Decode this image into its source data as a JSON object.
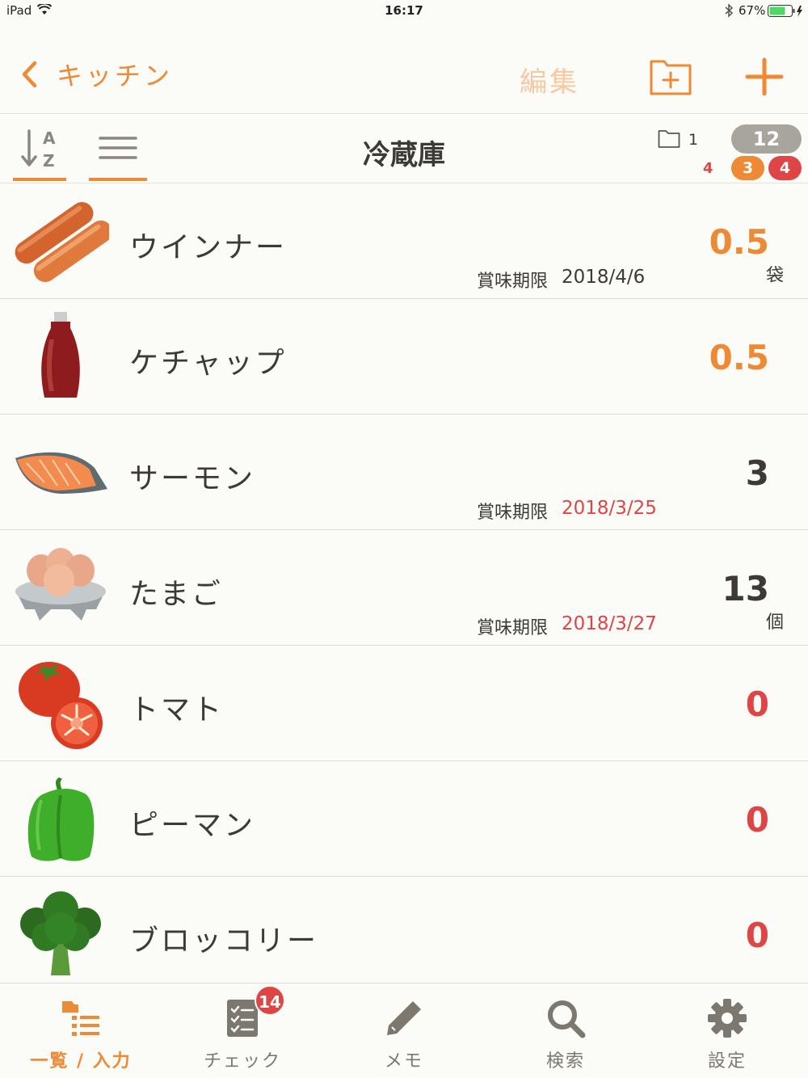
{
  "status_bar": {
    "device": "iPad",
    "time": "16:17",
    "battery": "67%"
  },
  "nav": {
    "back_label": "キッチン",
    "edit_label": "編集",
    "back_icon": "chevron-left-icon",
    "add_folder_icon": "folder-plus-icon",
    "add_icon": "plus-icon"
  },
  "toolbar": {
    "title": "冷蔵庫",
    "folder_count": "1",
    "warning_count": "4",
    "total_badge": "12",
    "orange_badge": "3",
    "red_badge": "4"
  },
  "items": [
    {
      "name": "ウインナー",
      "quantity": "0.5",
      "unit": "袋",
      "expiry_label": "賞味期限",
      "expiry_date": "2018/4/6",
      "icon": "sausage"
    },
    {
      "name": "ケチャップ",
      "quantity": "0.5",
      "unit": "",
      "expiry_label": "",
      "expiry_date": "",
      "icon": "ketchup"
    },
    {
      "name": "サーモン",
      "quantity": "3",
      "unit": "",
      "expiry_label": "賞味期限",
      "expiry_date": "2018/3/25",
      "icon": "salmon"
    },
    {
      "name": "たまご",
      "quantity": "13",
      "unit": "個",
      "expiry_label": "賞味期限",
      "expiry_date": "2018/3/27",
      "icon": "eggs"
    },
    {
      "name": "トマト",
      "quantity": "0",
      "unit": "",
      "expiry_label": "",
      "expiry_date": "",
      "icon": "tomato"
    },
    {
      "name": "ピーマン",
      "quantity": "0",
      "unit": "",
      "expiry_label": "",
      "expiry_date": "",
      "icon": "green-pepper"
    },
    {
      "name": "ブロッコリー",
      "quantity": "0",
      "unit": "",
      "expiry_label": "",
      "expiry_date": "",
      "icon": "broccoli"
    }
  ],
  "tabs": [
    {
      "label": "一覧 / 入力",
      "icon": "list-icon",
      "active": true
    },
    {
      "label": "チェック",
      "icon": "checklist-icon",
      "badge": "14"
    },
    {
      "label": "メモ",
      "icon": "pencil-icon"
    },
    {
      "label": "検索",
      "icon": "search-icon"
    },
    {
      "label": "設定",
      "icon": "gear-icon"
    }
  ],
  "colors": {
    "accent": "#ee8a35",
    "alert": "#e04545",
    "text": "#3d3a36"
  }
}
